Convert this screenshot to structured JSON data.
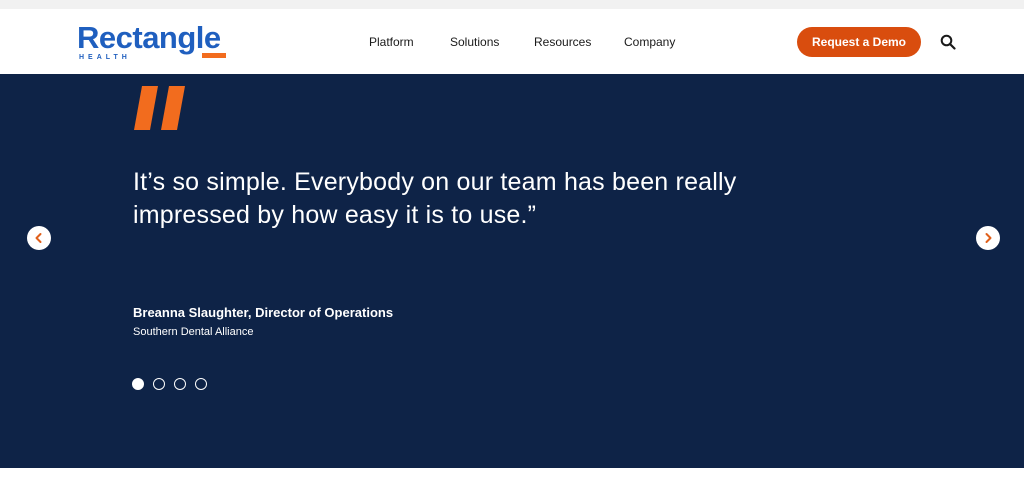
{
  "brand": {
    "name": "Rectangle",
    "sub": "HEALTH",
    "primary_color": "#1f5fbf",
    "accent_color": "#f26c1e"
  },
  "nav": {
    "items": [
      {
        "label": "Platform"
      },
      {
        "label": "Solutions"
      },
      {
        "label": "Resources"
      },
      {
        "label": "Company"
      }
    ],
    "cta_label": "Request a Demo",
    "search_icon": "search-icon"
  },
  "testimonial": {
    "quote": "It’s so simple. Everybody on our team has been really impressed by how easy it is to use.”",
    "author": "Breanna Slaughter, Director of Operations",
    "organization": "Southern Dental Alliance",
    "background_color": "#0e2347"
  },
  "carousel": {
    "slide_count": 4,
    "active_index": 0,
    "prev_icon": "chevron-left-icon",
    "next_icon": "chevron-right-icon"
  }
}
